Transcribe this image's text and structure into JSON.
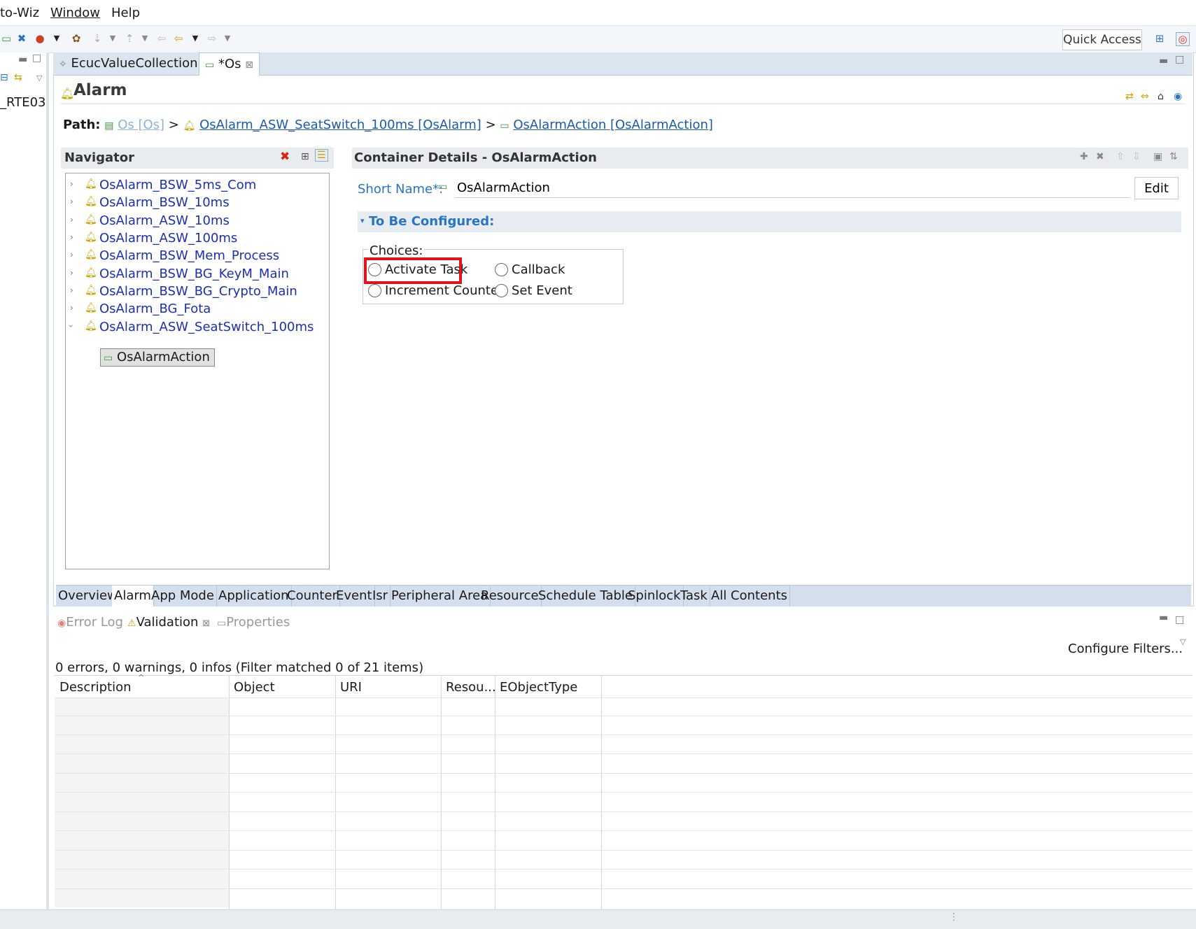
{
  "menubar": {
    "items": [
      "to-Wiz",
      "Window",
      "Help"
    ]
  },
  "toolbar": {
    "quick_access": "Quick Access"
  },
  "left_panel": {
    "item": "_RTE03"
  },
  "editor": {
    "tabs": [
      {
        "label": "EcucValueCollection"
      },
      {
        "label": "*Os"
      }
    ],
    "title": "Alarm",
    "path": {
      "label": "Path:",
      "seg1": "Os [Os]",
      "sep": ">",
      "seg2": "OsAlarm_ASW_SeatSwitch_100ms [OsAlarm]",
      "seg3": "OsAlarmAction [OsAlarmAction]"
    }
  },
  "navigator": {
    "title": "Navigator",
    "items": [
      {
        "label": "OsAlarm_BSW_5ms_Com"
      },
      {
        "label": "OsAlarm_BSW_10ms"
      },
      {
        "label": "OsAlarm_ASW_10ms"
      },
      {
        "label": "OsAlarm_ASW_100ms"
      },
      {
        "label": "OsAlarm_BSW_Mem_Process"
      },
      {
        "label": "OsAlarm_BSW_BG_KeyM_Main"
      },
      {
        "label": "OsAlarm_BSW_BG_Crypto_Main"
      },
      {
        "label": "OsAlarm_BG_Fota"
      },
      {
        "label": "OsAlarm_ASW_SeatSwitch_100ms"
      }
    ],
    "child": "OsAlarmAction"
  },
  "details": {
    "title": "Container Details - OsAlarmAction",
    "short_name_label": "Short Name*:",
    "short_name_value": "OsAlarmAction",
    "edit_label": "Edit",
    "section": "To Be Configured:",
    "choices_label": "Choices:",
    "choices": [
      "Activate Task",
      "Callback",
      "Increment Counter",
      "Set Event"
    ]
  },
  "page_tabs": [
    "Overview",
    "Alarm",
    "App Mode",
    "Application",
    "Counter",
    "Event",
    "Isr",
    "Peripheral Area",
    "Resource",
    "Schedule Table",
    "Spinlock",
    "Task",
    "All Contents"
  ],
  "bottom_panel": {
    "tabs": [
      "Error Log",
      "Validation",
      "Properties"
    ],
    "configure_filters": "Configure Filters...",
    "summary": "0 errors, 0 warnings, 0 infos (Filter matched 0 of 21 items)",
    "columns": [
      "Description",
      "Object",
      "URI",
      "Resou...",
      "EObjectType"
    ]
  },
  "colors": {
    "link": "#1a5aa6",
    "tree_text": "#1b2fb5",
    "accent_label": "#2a74c0",
    "highlight": "#e3121b"
  }
}
